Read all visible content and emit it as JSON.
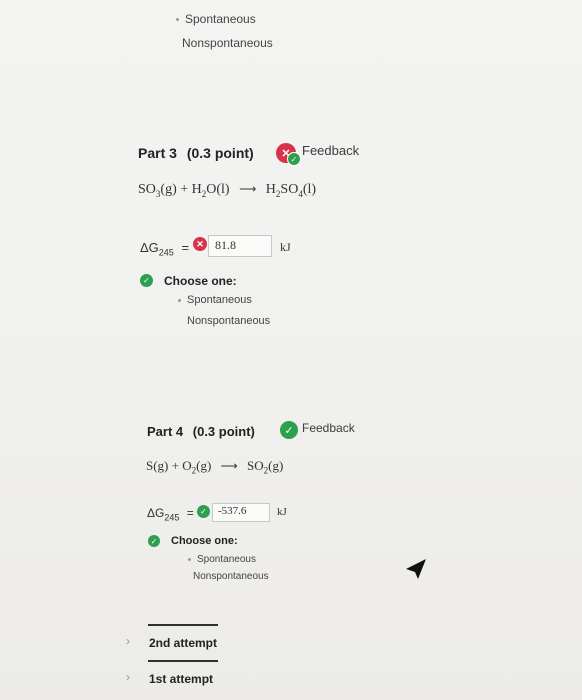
{
  "top_options": [
    "Spontaneous",
    "Nonspontaneous"
  ],
  "part3": {
    "title": "Part 3",
    "points": "(0.3 point)",
    "feedback": "Feedback",
    "eq_left": "SO",
    "eq_sub1": "3",
    "eq_g": "(g) + H",
    "eq_sub2": "2",
    "eq_o": "O(l)",
    "eq_arrow": "⟶",
    "eq_right_h": "H",
    "eq_sub3": "2",
    "eq_so": "SO",
    "eq_sub4": "4",
    "eq_l": "(l)",
    "dg_label": "ΔG",
    "dg_sub": "245",
    "dg_eq": "=",
    "dg_value": "81.8",
    "unit": "kJ",
    "choose": "Choose one:",
    "options": [
      "Spontaneous",
      "Nonspontaneous"
    ],
    "status_colors": {
      "incorrect": "#d9334a",
      "correct": "#2e9e4f"
    }
  },
  "part4": {
    "title": "Part 4",
    "points": "(0.3 point)",
    "feedback": "Feedback",
    "eq_s": "S(g) + O",
    "eq_sub1": "2",
    "eq_g": "(g)",
    "eq_arrow": "⟶",
    "eq_so": "SO",
    "eq_sub2": "2",
    "eq_g2": "(g)",
    "dg_label": "ΔG",
    "dg_sub": "245",
    "dg_eq": "=",
    "dg_value": "-537.6",
    "unit": "kJ",
    "choose": "Choose one:",
    "options": [
      "Spontaneous",
      "Nonspontaneous"
    ]
  },
  "attempts": [
    "2nd attempt",
    "1st attempt"
  ]
}
